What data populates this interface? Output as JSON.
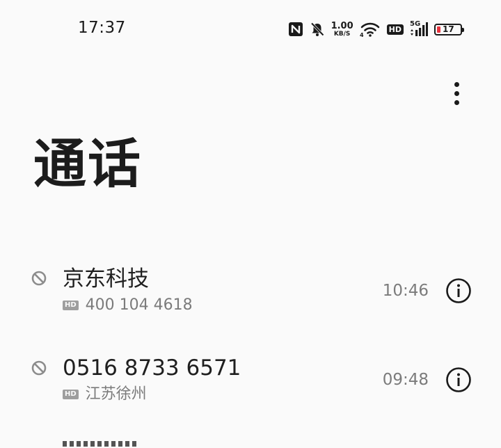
{
  "status_bar": {
    "time": "17:37",
    "net_speed_value": "1.00",
    "net_speed_unit": "KB/S",
    "hd_label": "HD",
    "signal_label": "5G",
    "battery_level": "17",
    "battery_color": "#e8323c"
  },
  "header": {
    "title": "通话",
    "more_icon": "more-vert-icon"
  },
  "calls": [
    {
      "name": "京东科技",
      "badge": "HD",
      "detail": "400 104 4618",
      "time": "10:46",
      "status_icon": "blocked-icon",
      "action_icon": "info-icon"
    },
    {
      "name": "0516 8733 6571",
      "badge": "HD",
      "detail": "江苏徐州",
      "time": "09:48",
      "status_icon": "blocked-icon",
      "action_icon": "info-icon"
    }
  ]
}
